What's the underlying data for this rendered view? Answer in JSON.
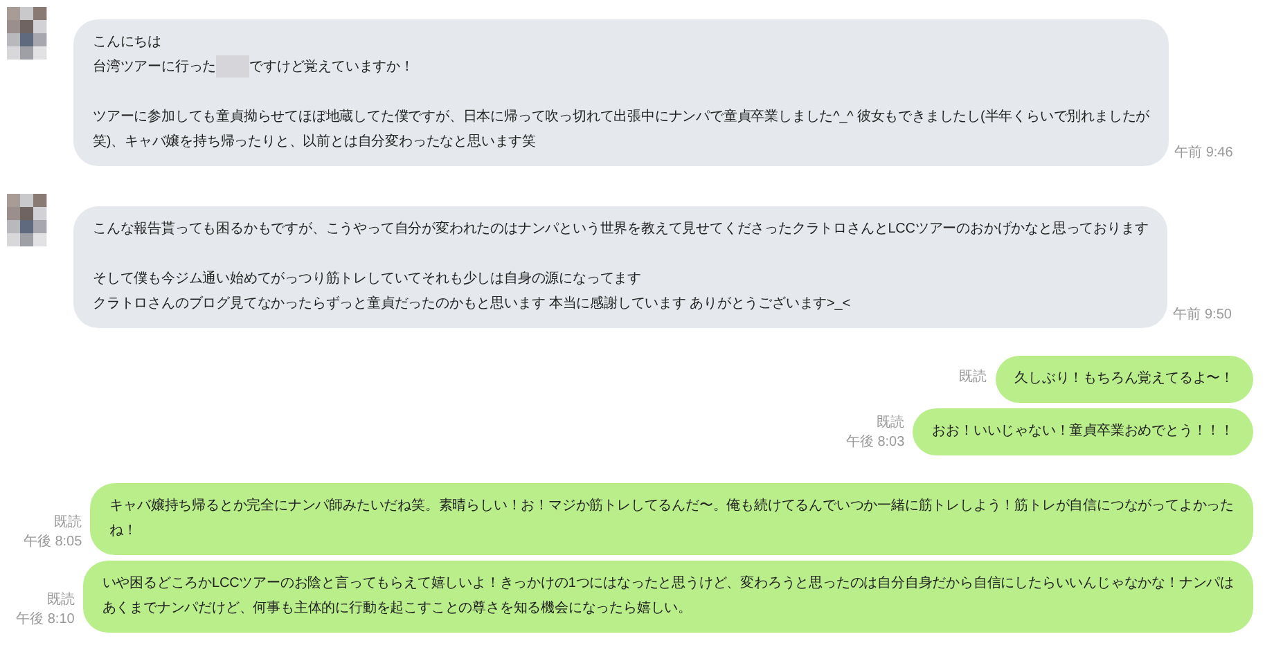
{
  "messages": [
    {
      "kind": "incoming",
      "paragraphs": [
        [
          "こんにちは",
          [
            {
              "kind": "text",
              "text": "台湾ツアーに行った"
            },
            {
              "kind": "redacted"
            },
            {
              "kind": "text",
              "text": "ですけど覚えていますか！"
            }
          ]
        ],
        [
          "ツアーに参加しても童貞拗らせてほぼ地蔵してた僕ですが、日本に帰って吹っ切れて出張中にナンパで童貞卒業しました^_^ 彼女もできましたし(半年くらいで別れましたが",
          "笑)、キャバ嬢を持ち帰ったりと、以前とは自分変わったなと思います笑"
        ]
      ],
      "time": "午前 9:46"
    },
    {
      "kind": "incoming",
      "paragraphs": [
        [
          "こんな報告貰っても困るかもですが、こうやって自分が変われたのはナンパという世界を教えて見せてくださったクラトロさんとLCCツアーのおかげかなと思っております"
        ],
        [
          "そして僕も今ジム通い始めてがっつり筋トレしていてそれも少しは自身の源になってます",
          "クラトロさんのブログ見てなかったらずっと童貞だったのかもと思います 本当に感謝しています ありがとうございます>_<"
        ]
      ],
      "time": "午前 9:50"
    },
    {
      "kind": "outgoing",
      "paragraphs": [
        [
          "久しぶり！もちろん覚えてるよ〜！"
        ]
      ],
      "read": "既読"
    },
    {
      "kind": "outgoing",
      "paragraphs": [
        [
          "おお！いいじゃない！童貞卒業おめでとう！！！"
        ]
      ],
      "read": "既読",
      "time": "午後 8:03"
    },
    {
      "kind": "outgoing",
      "paragraphs": [
        [
          "キャバ嬢持ち帰るとか完全にナンパ師みたいだね笑。素晴らしい！お！マジか筋トレしてるんだ〜。俺も続けてるんでいつか一緒に筋トレしよう！筋トレが自信につながってよかった",
          "ね！"
        ]
      ],
      "read": "既読",
      "time": "午後 8:05"
    },
    {
      "kind": "outgoing",
      "paragraphs": [
        [
          "いや困るどころかLCCツアーのお陰と言ってもらえて嬉しいよ！きっかけの1つにはなったと思うけど、変わろうと思ったのは自分自身だから自信にしたらいいんじゃなかな！ナンパは",
          "あくまでナンパだけど、何事も主体的に行動を起こすことの尊さを知る機会になったら嬉しい。"
        ]
      ],
      "read": "既読",
      "time": "午後 8:10"
    }
  ]
}
